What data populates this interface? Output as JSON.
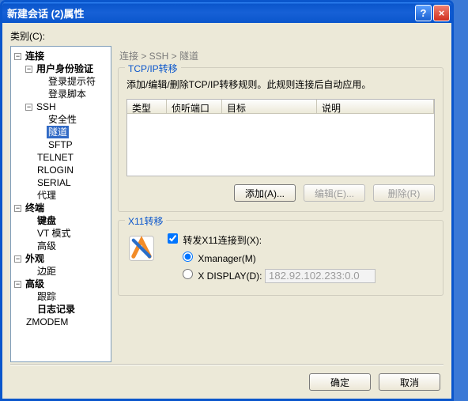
{
  "window": {
    "title": "新建会话 (2)属性"
  },
  "category_label": "类别(C):",
  "tree": {
    "connection": "连接",
    "userauth": "用户身份验证",
    "loginprompt": "登录提示符",
    "loginscript": "登录脚本",
    "ssh": "SSH",
    "security": "安全性",
    "tunnel": "隧道",
    "sftp": "SFTP",
    "telnet": "TELNET",
    "rlogin": "RLOGIN",
    "serial": "SERIAL",
    "proxy": "代理",
    "terminal": "终端",
    "keyboard": "键盘",
    "vtmode": "VT 模式",
    "advanced_t": "高级",
    "appearance": "外观",
    "margin": "边距",
    "advanced": "高级",
    "trace": "跟踪",
    "logging": "日志记录",
    "zmodem": "ZMODEM"
  },
  "breadcrumb": "连接 > SSH > 隧道",
  "tcp": {
    "legend": "TCP/IP转移",
    "desc": "添加/编辑/删除TCP/IP转移规则。此规则连接后自动应用。",
    "col_type": "类型",
    "col_listen": "侦听端口",
    "col_target": "目标",
    "col_desc": "说明",
    "btn_add": "添加(A)...",
    "btn_edit": "编辑(E)...",
    "btn_del": "删除(R)"
  },
  "x11": {
    "legend": "X11转移",
    "forward_label": "转发X11连接到(X):",
    "opt_xmanager": "Xmanager(M)",
    "opt_xdisplay": "X DISPLAY(D):",
    "display_value": "182.92.102.233:0.0"
  },
  "footer": {
    "ok": "确定",
    "cancel": "取消"
  }
}
